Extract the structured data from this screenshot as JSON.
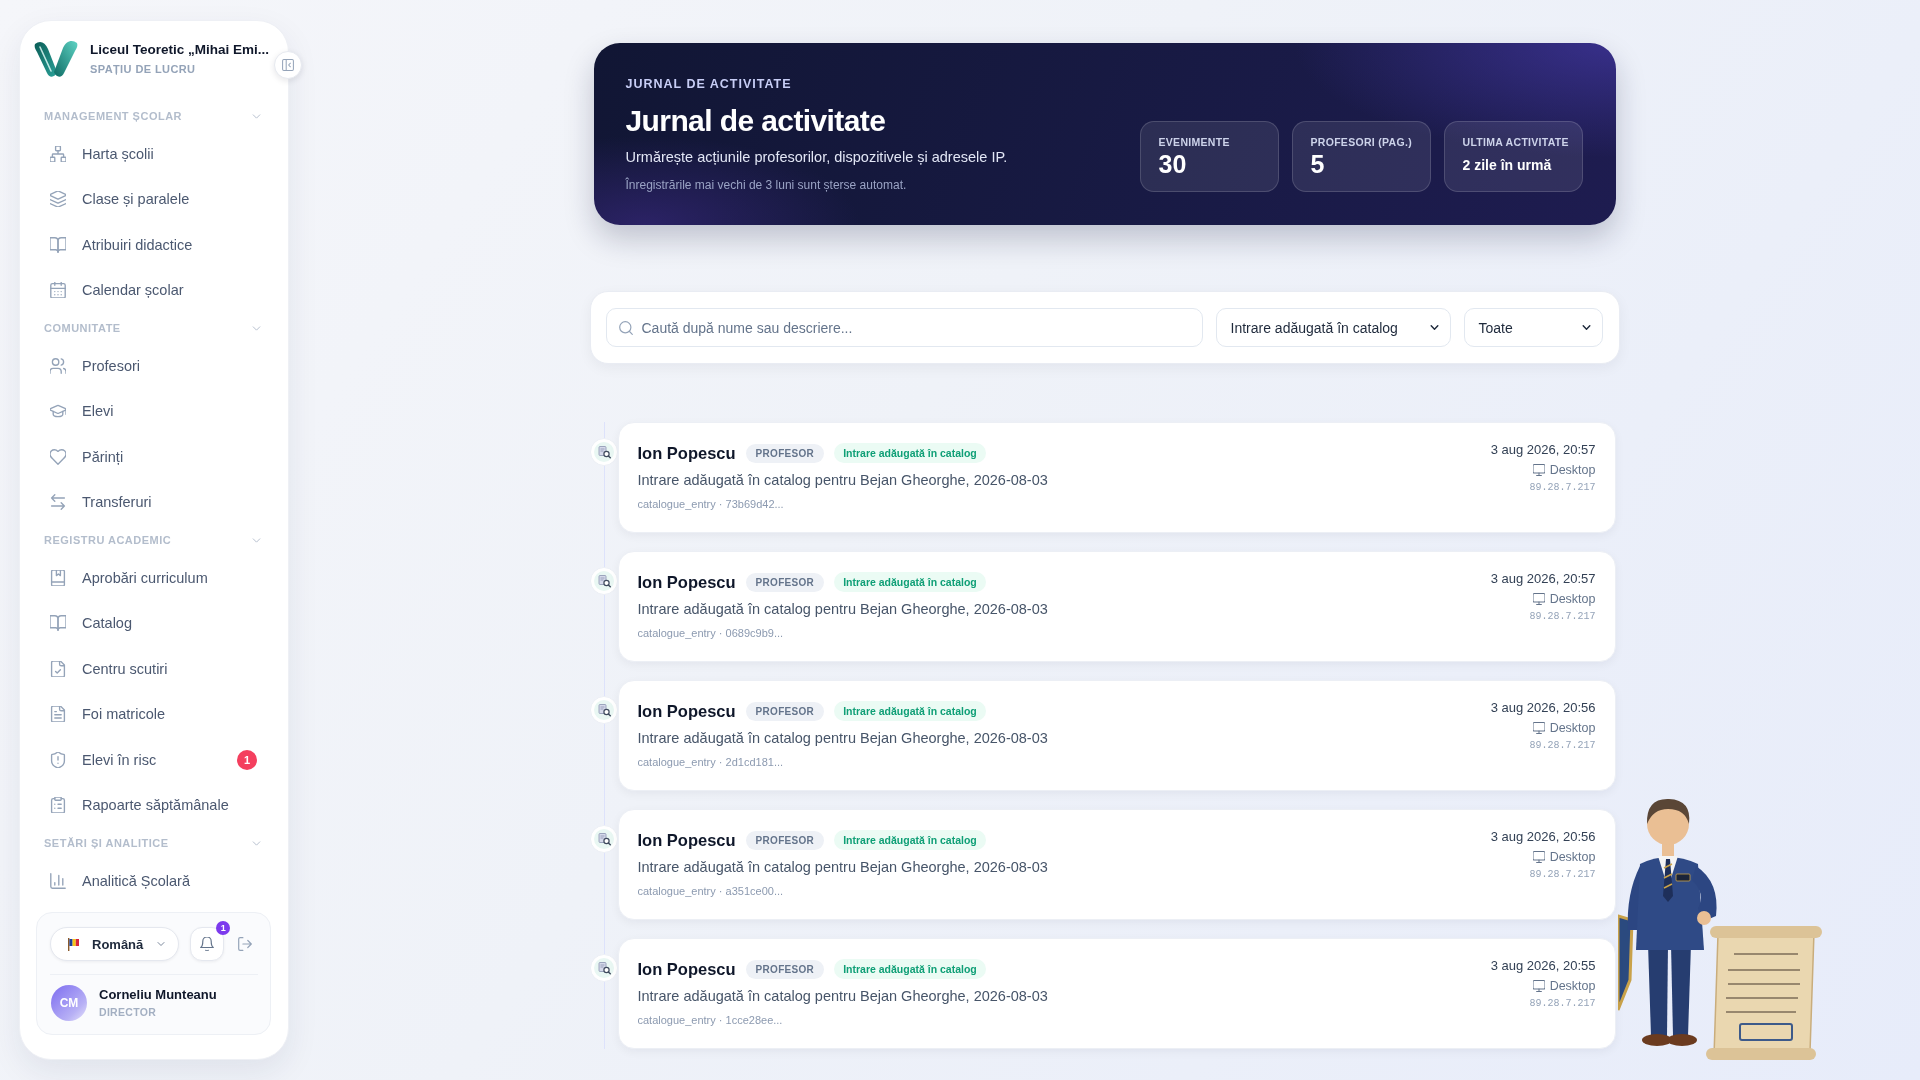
{
  "sidebar": {
    "school_name": "Liceul Teoretic „Mihai Emi...",
    "workspace_label": "SPAȚIU DE LUCRU",
    "sections": [
      {
        "title": "MANAGEMENT ȘCOLAR",
        "expanded": true,
        "items": [
          {
            "label": "Harta școlii",
            "selected": false
          },
          {
            "label": "Clase și paralele",
            "selected": false
          },
          {
            "label": "Atribuiri didactice",
            "selected": false
          },
          {
            "label": "Calendar școlar",
            "selected": false
          }
        ]
      },
      {
        "title": "COMUNITATE",
        "expanded": true,
        "items": [
          {
            "label": "Profesori",
            "selected": false
          },
          {
            "label": "Elevi",
            "selected": false
          },
          {
            "label": "Părinți",
            "selected": false
          },
          {
            "label": "Transferuri",
            "selected": false
          }
        ]
      },
      {
        "title": "REGISTRU ACADEMIC",
        "expanded": true,
        "items": [
          {
            "label": "Aprobări curriculum",
            "selected": false
          },
          {
            "label": "Catalog",
            "selected": false
          },
          {
            "label": "Centru scutiri",
            "selected": false
          },
          {
            "label": "Foi matricole",
            "selected": false
          },
          {
            "label": "Elevi în risc",
            "selected": false,
            "badge": "1"
          },
          {
            "label": "Rapoarte săptămânale",
            "selected": false
          }
        ]
      },
      {
        "title": "SETĂRI ȘI ANALITICE",
        "expanded": true,
        "items": [
          {
            "label": "Analitică Școlară",
            "selected": false
          }
        ]
      }
    ],
    "footer": {
      "language": "Română",
      "notification_count": "1",
      "user": {
        "initials": "CM",
        "name": "Corneliu Munteanu",
        "role": "DIRECTOR"
      }
    }
  },
  "header": {
    "eyebrow": "JURNAL DE ACTIVITATE",
    "title": "Jurnal de activitate",
    "subtitle": "Urmărește acțiunile profesorilor, dispozitivele și adresele IP.",
    "note": "Înregistrările mai vechi de 3 luni sunt șterse automat.",
    "stats": [
      {
        "label": "EVENIMENTE",
        "value": "30",
        "kind": "count"
      },
      {
        "label": "PROFESORI (PAG.)",
        "value": "5",
        "kind": "count"
      },
      {
        "label": "ULTIMA ACTIVITATE",
        "value": "2 zile în urmă",
        "kind": "text"
      }
    ]
  },
  "filters": {
    "search": {
      "placeholder": "Caută după nume sau descriere..."
    },
    "action_filter": "Intrare adăugată în catalog",
    "role_filter": "Toate"
  },
  "entries": [
    {
      "author": "Ion Popescu",
      "role": "PROFESOR",
      "action": "Intrare adăugată în catalog",
      "description": "Intrare adăugată în catalog pentru Bejan Gheorghe, 2026-08-03",
      "meta": "catalogue_entry · 73b69d42...",
      "time": "3 aug 2026, 20:57",
      "device": "Desktop",
      "ip": "89.28.7.217"
    },
    {
      "author": "Ion Popescu",
      "role": "PROFESOR",
      "action": "Intrare adăugată în catalog",
      "description": "Intrare adăugată în catalog pentru Bejan Gheorghe, 2026-08-03",
      "meta": "catalogue_entry · 0689c9b9...",
      "time": "3 aug 2026, 20:57",
      "device": "Desktop",
      "ip": "89.28.7.217"
    },
    {
      "author": "Ion Popescu",
      "role": "PROFESOR",
      "action": "Intrare adăugată în catalog",
      "description": "Intrare adăugată în catalog pentru Bejan Gheorghe, 2026-08-03",
      "meta": "catalogue_entry · 2d1cd181...",
      "time": "3 aug 2026, 20:56",
      "device": "Desktop",
      "ip": "89.28.7.217"
    },
    {
      "author": "Ion Popescu",
      "role": "PROFESOR",
      "action": "Intrare adăugată în catalog",
      "description": "Intrare adăugată în catalog pentru Bejan Gheorghe, 2026-08-03",
      "meta": "catalogue_entry · a351ce00...",
      "time": "3 aug 2026, 20:56",
      "device": "Desktop",
      "ip": "89.28.7.217"
    },
    {
      "author": "Ion Popescu",
      "role": "PROFESOR",
      "action": "Intrare adăugată în catalog",
      "description": "Intrare adăugată în catalog pentru Bejan Gheorghe, 2026-08-03",
      "meta": "catalogue_entry · 1cce28ee...",
      "time": "3 aug 2026, 20:55",
      "device": "Desktop",
      "ip": "89.28.7.217"
    }
  ]
}
